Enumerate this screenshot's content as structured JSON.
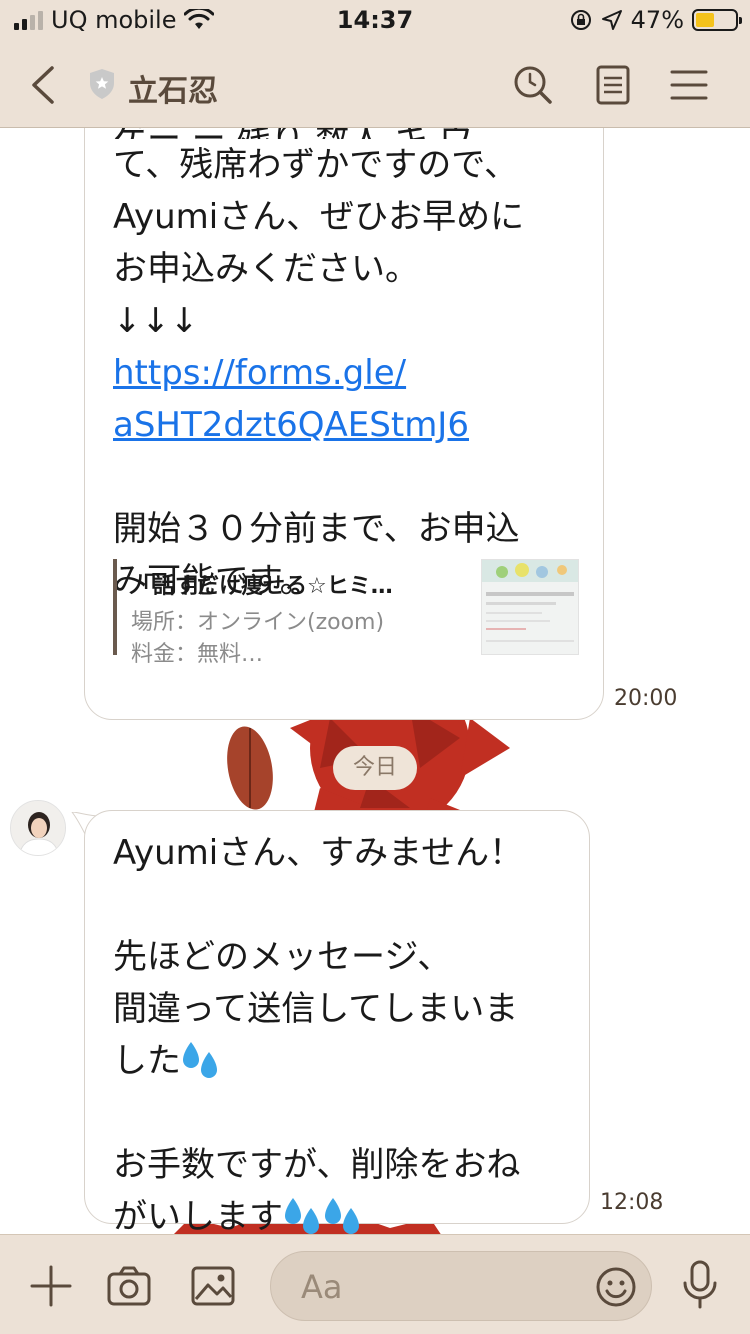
{
  "status": {
    "carrier": "UQ mobile",
    "time": "14:37",
    "battery_text": "47%",
    "battery_level": 0.47
  },
  "header": {
    "title": "立石忍"
  },
  "messages": {
    "first": {
      "cut_line": "ゲー ー 残り 数人 キ ウ",
      "lines": [
        "て、残席わずかですので、",
        "Ayumiさん、ぜひお早めに",
        "お申込みください。",
        "↓↓↓"
      ],
      "link_line1": "https://forms.gle/",
      "link_line2": "aSHT2dzt6QAEStmJ6",
      "after_lines": [
        "開始３０分前まで、お申込",
        "み可能です。"
      ],
      "preview": {
        "title": "「話すだけ痩せる☆ヒミ…",
        "line1": "場所：オンライン(zoom)",
        "line2": "料金：無料…"
      },
      "time": "20:00"
    },
    "date_chip": "今日",
    "second": {
      "line1": "Ayumiさん、すみません！",
      "line2": "先ほどのメッセージ、",
      "line3": "間違って送信してしまいま",
      "line4": "した",
      "line5": "お手数ですが、削除をおね",
      "line6": "がいします",
      "time": "12:08"
    }
  },
  "composer": {
    "placeholder": "Aa"
  }
}
